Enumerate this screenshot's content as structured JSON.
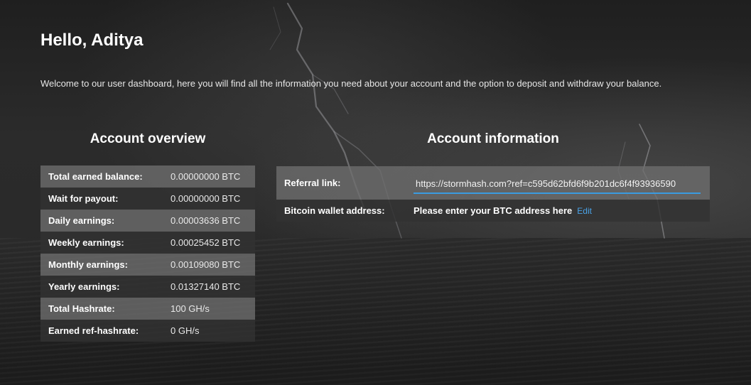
{
  "greeting": "Hello, Aditya",
  "intro": "Welcome to our user dashboard, here you will find all the information you need about your account and the option to deposit and withdraw your balance.",
  "overview": {
    "title": "Account overview",
    "rows": [
      {
        "label": "Total earned balance:",
        "value": "0.00000000 BTC"
      },
      {
        "label": "Wait for payout:",
        "value": "0.00000000 BTC"
      },
      {
        "label": "Daily earnings:",
        "value": "0.00003636 BTC"
      },
      {
        "label": "Weekly earnings:",
        "value": "0.00025452 BTC"
      },
      {
        "label": "Monthly earnings:",
        "value": "0.00109080 BTC"
      },
      {
        "label": "Yearly earnings:",
        "value": "0.01327140 BTC"
      },
      {
        "label": "Total Hashrate:",
        "value": "100 GH/s"
      },
      {
        "label": "Earned ref-hashrate:",
        "value": "0 GH/s"
      }
    ]
  },
  "info": {
    "title": "Account information",
    "referral_label": "Referral link:",
    "referral_value": "https://stormhash.com?ref=c595d62bfd6f9b201dc6f4f93936590",
    "wallet_label": "Bitcoin wallet address:",
    "wallet_value": "Please enter your BTC address here",
    "edit_label": "Edit"
  },
  "colors": {
    "accent": "#3a9be0",
    "link": "#4aa3e8",
    "row_light": "#6e6e6e",
    "row_dark": "#323232"
  }
}
